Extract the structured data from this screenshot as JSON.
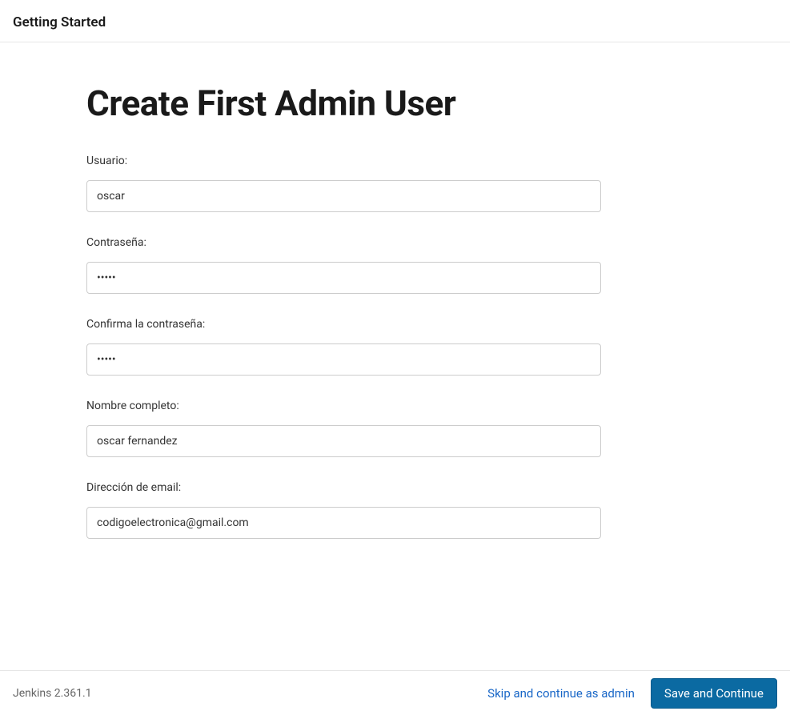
{
  "header": {
    "title": "Getting Started"
  },
  "page": {
    "title": "Create First Admin User"
  },
  "form": {
    "username": {
      "label": "Usuario:",
      "value": "oscar"
    },
    "password": {
      "label": "Contraseña:",
      "value": "•••••"
    },
    "confirm_password": {
      "label": "Confirma la contraseña:",
      "value": "•••••"
    },
    "full_name": {
      "label": "Nombre completo:",
      "value": "oscar fernandez"
    },
    "email": {
      "label": "Dirección de email:",
      "value": "codigoelectronica@gmail.com"
    }
  },
  "footer": {
    "version": "Jenkins 2.361.1",
    "skip_label": "Skip and continue as admin",
    "save_label": "Save and Continue"
  }
}
